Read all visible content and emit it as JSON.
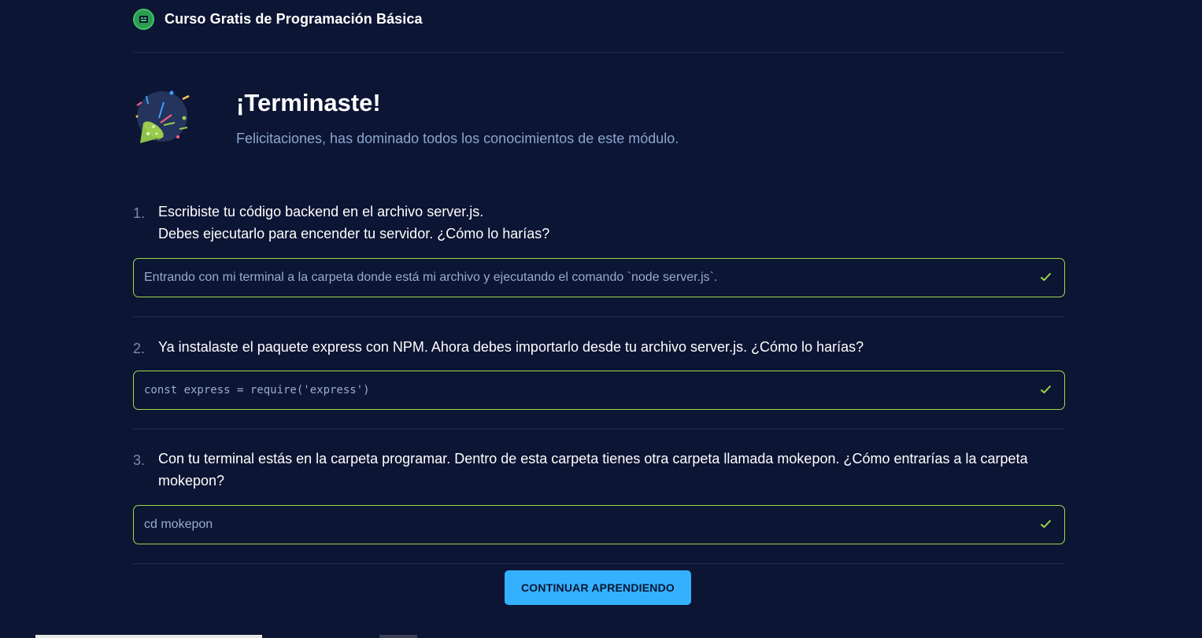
{
  "header": {
    "course_title": "Curso Gratis de Programación Básica",
    "logo_icon": "course-logo-icon"
  },
  "result": {
    "title": "¡Terminaste!",
    "subtitle": "Felicitaciones, has dominado todos los conocimientos de este módulo.",
    "icon": "party-popper-icon"
  },
  "questions": [
    {
      "number": "1.",
      "text": "Escribiste tu código backend en el archivo server.js.\nDebes ejecutarlo para encender tu servidor. ¿Cómo lo harías?",
      "answer": "Entrando con mi terminal a la carpeta donde está mi archivo y ejecutando el comando `node server.js`.",
      "correct": true
    },
    {
      "number": "2.",
      "text": "Ya instalaste el paquete express con NPM. Ahora debes importarlo desde tu archivo server.js. ¿Cómo lo harías?",
      "answer": "const express = require('express')",
      "correct": true
    },
    {
      "number": "3.",
      "text": "Con tu terminal estás en la carpeta programar. Dentro de esta carpeta tienes otra carpeta llamada mokepon. ¿Cómo entrarías a la carpeta mokepon?",
      "answer": "cd mokepon",
      "correct": true
    }
  ],
  "actions": {
    "continue_label": "CONTINUAR APRENDIENDO"
  },
  "colors": {
    "background": "#0c1533",
    "accent": "#33b1ff",
    "correct_border": "#9ed94a",
    "check": "#9ed94a"
  }
}
